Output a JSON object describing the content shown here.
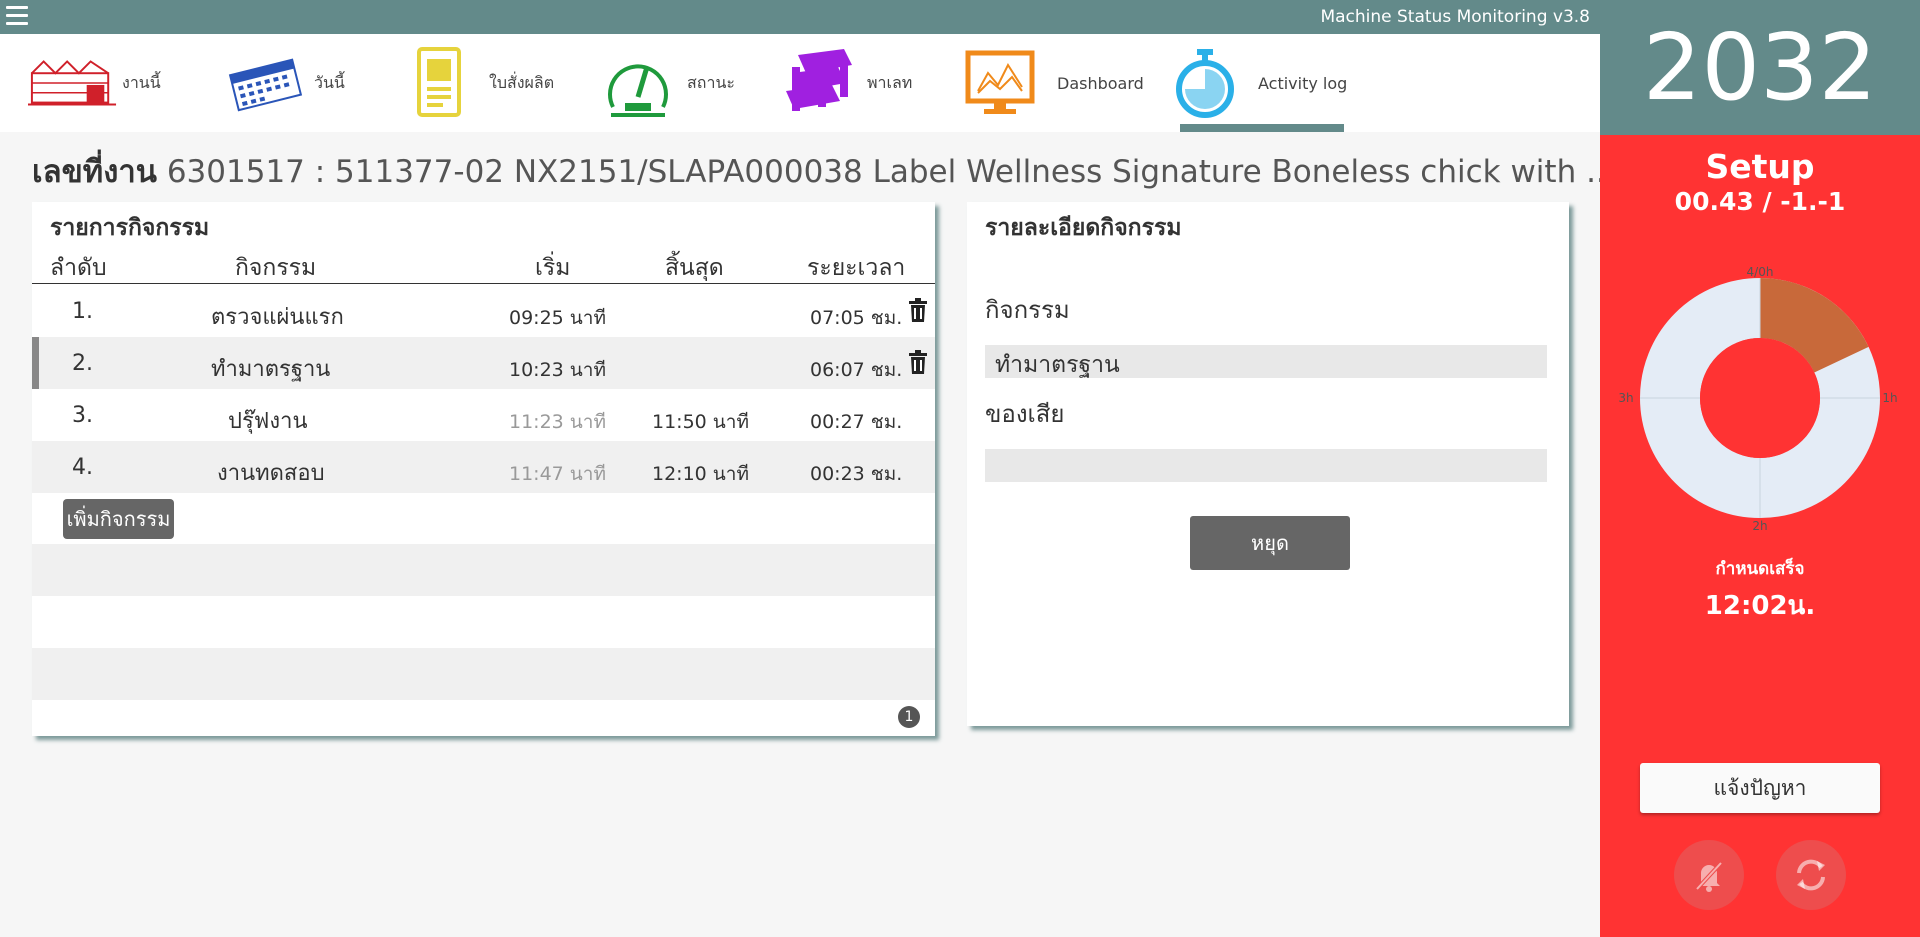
{
  "app": {
    "title": "Machine Status Monitoring v3.8"
  },
  "nav": {
    "items": [
      {
        "label": "งานนี้",
        "icon": "factory-icon"
      },
      {
        "label": "วันนี้",
        "icon": "calendar-icon"
      },
      {
        "label": "ใบสั่งผลิต",
        "icon": "document-icon"
      },
      {
        "label": "สถานะ",
        "icon": "gauge-icon"
      },
      {
        "label": "พาเลท",
        "icon": "pallet-icon"
      },
      {
        "label": "Dashboard",
        "icon": "chart-icon"
      },
      {
        "label": "Activity log",
        "icon": "stopwatch-icon"
      }
    ],
    "active": "Activity log"
  },
  "job": {
    "prefix": "เลขที่งาน",
    "text": "6301517 : 511377-02 NX2151/SLAPA000038 Label Wellness Signature Boneless chick with ..."
  },
  "activities": {
    "heading": "รายการกิจกรรม",
    "columns": [
      "ลำดับ",
      "กิจกรรม",
      "เริ่ม",
      "สิ้นสุด",
      "ระยะเวลา"
    ],
    "rows": [
      {
        "no": "1.",
        "activity": "ตรวจแผ่นแรก",
        "start": "09:25 นาที",
        "end": "",
        "duration": "07:05 ชม."
      },
      {
        "no": "2.",
        "activity": "ทำมาตรฐาน",
        "start": "10:23 นาที",
        "end": "",
        "duration": "06:07 ชม."
      },
      {
        "no": "3.",
        "activity": "ปรุ๊ฟงาน",
        "start": "11:23 นาที",
        "end": "11:50 นาที",
        "duration": "00:27 ชม."
      },
      {
        "no": "4.",
        "activity": "งานทดสอบ",
        "start": "11:47 นาที",
        "end": "12:10 นาที",
        "duration": "00:23 ชม."
      }
    ],
    "add_button": "เพิ่มกิจกรรม",
    "page": "1"
  },
  "detail": {
    "heading": "รายละเอียดกิจกรรม",
    "activity_label": "กิจกรรม",
    "activity_value": "ทำมาตรฐาน",
    "waste_label": "ของเสีย",
    "waste_value": "",
    "stop_button": "หยุด"
  },
  "sidebar": {
    "counter": "2032",
    "status": "Setup",
    "status_detail": "00.43 / -1.-1",
    "clock_labels": {
      "top": "4/0h",
      "right": "1h",
      "bottom": "2h",
      "left": "3h"
    },
    "progress": 0.18,
    "due_label": "กำหนดเสร็จ",
    "due_time": "12:02น.",
    "report_button": "แจ้งปัญหา",
    "mute_icon": "bell-off-icon",
    "refresh_icon": "refresh-icon"
  },
  "colors": {
    "header": "#638a8a",
    "sidebar": "#ff3333",
    "donut_track": "#e4ecf6",
    "donut_fill": "#c8693a"
  }
}
